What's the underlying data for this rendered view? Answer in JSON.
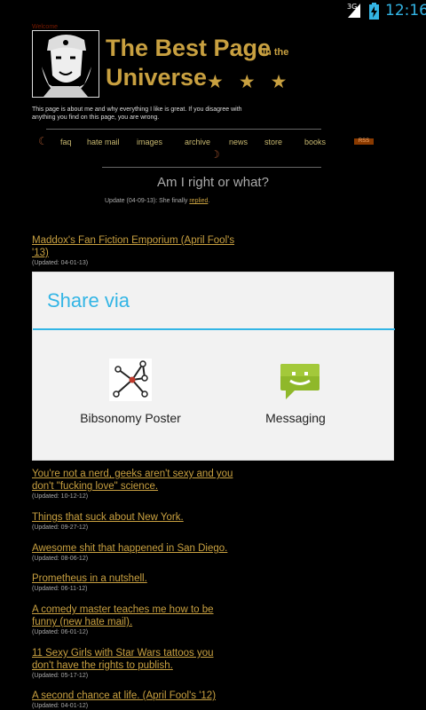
{
  "status_bar": {
    "network": "3G",
    "time": "12:16"
  },
  "page": {
    "welcome_text": "Welcome",
    "title_line1": "The Best Page",
    "title_in_the": "in the",
    "title_line2": "Universe",
    "stars": "★★★",
    "intro": "This page is about me and why everything I like is great. If you disagree with anything you find on this page, you are wrong.",
    "nav": [
      {
        "label": "faq"
      },
      {
        "label": "hate mail"
      },
      {
        "label": "images"
      },
      {
        "label": "archive"
      },
      {
        "label": "news"
      },
      {
        "label": "store"
      },
      {
        "label": "books"
      }
    ],
    "rss_label": "RSS",
    "question": "Am I right or what?",
    "update_prefix": "Update (04-09-13): She finally ",
    "update_link": "replied",
    "update_suffix": ".",
    "posts": [
      {
        "title": "Maddox's Fan Fiction Emporium (April Fool's '13)",
        "date": "(Updated: 04-01-13)"
      },
      {
        "title": "You're not a nerd, geeks aren't sexy and you don't \"fucking love\" science.",
        "date": "(Updated: 10-12-12)"
      },
      {
        "title": "Things that suck about New York.",
        "date": "(Updated: 09-27-12)"
      },
      {
        "title": "Awesome shit that happened in San Diego.",
        "date": "(Updated: 08-06-12)"
      },
      {
        "title": "Prometheus in a nutshell.",
        "date": "(Updated: 06-11-12)"
      },
      {
        "title": "A comedy master teaches me how to be funny (new hate mail).",
        "date": "(Updated: 06-01-12)"
      },
      {
        "title": "11 Sexy Girls with Star Wars tattoos you don't have the rights to publish.",
        "date": "(Updated: 05-17-12)"
      },
      {
        "title": "A second chance at life. (April Fool's '12)",
        "date": "(Updated: 04-01-12)"
      }
    ]
  },
  "dialog": {
    "title": "Share via",
    "options": [
      {
        "label": "Bibsonomy Poster",
        "icon": "bibsonomy-icon"
      },
      {
        "label": "Messaging",
        "icon": "messaging-icon"
      }
    ]
  },
  "colors": {
    "accent": "#33b5e5",
    "link_gold": "#c8a040"
  }
}
